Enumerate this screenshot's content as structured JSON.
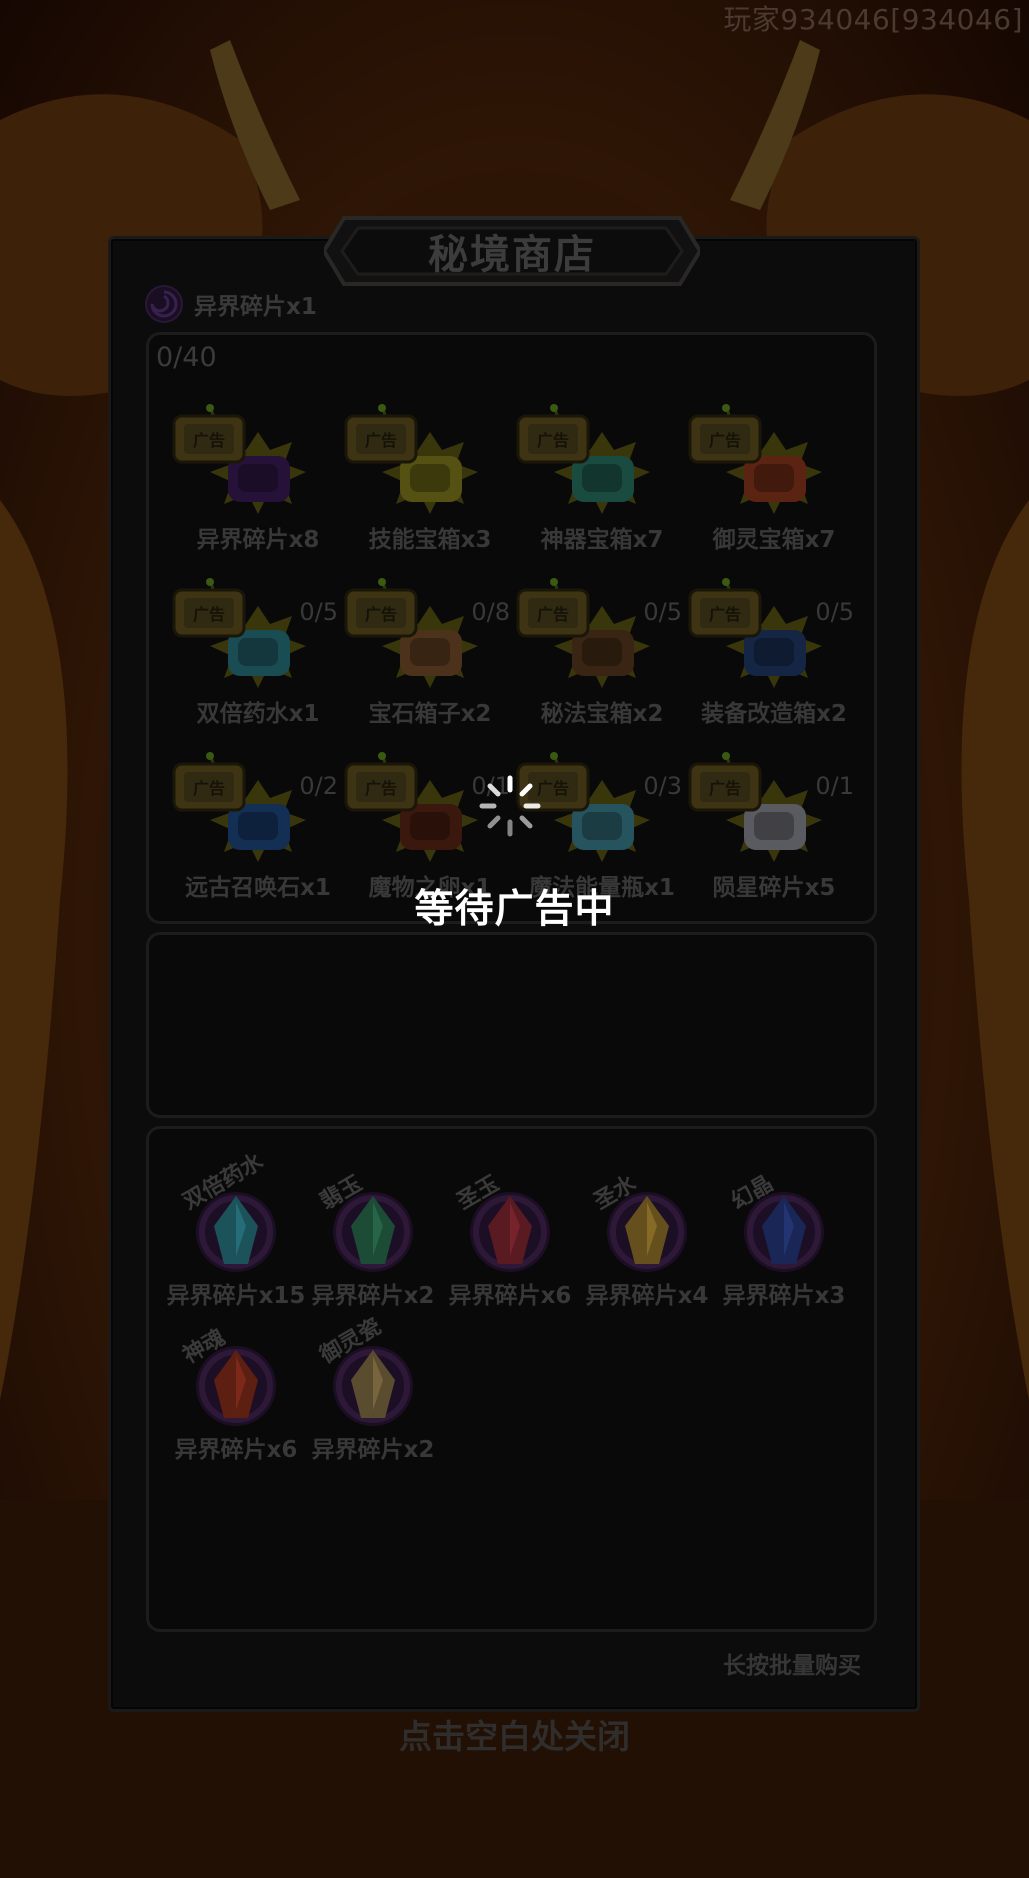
{
  "player": {
    "id_label": "玩家934046[934046]"
  },
  "shop": {
    "title": "秘境商店",
    "currency": {
      "label": "异界碎片x1",
      "icon": "void-fragment-icon"
    },
    "ad_counter": "0/40",
    "ad_items": [
      {
        "label": "异界碎片x8",
        "limit": "",
        "icon": "void-fragment-icon",
        "color": "#5a2a86"
      },
      {
        "label": "技能宝箱x3",
        "limit": "",
        "icon": "skill-chest-icon",
        "color": "#c7c22a"
      },
      {
        "label": "神器宝箱x7",
        "limit": "",
        "icon": "artifact-chest-icon",
        "color": "#3db39a"
      },
      {
        "label": "御灵宝箱x7",
        "limit": "",
        "icon": "spirit-chest-icon",
        "color": "#d8552a"
      },
      {
        "label": "双倍药水x1",
        "limit": "0/5",
        "icon": "double-potion-icon",
        "color": "#3fb6c9"
      },
      {
        "label": "宝石箱子x2",
        "limit": "0/8",
        "icon": "gem-bag-icon",
        "color": "#b87840"
      },
      {
        "label": "秘法宝箱x2",
        "limit": "0/5",
        "icon": "arcane-chest-icon",
        "color": "#8a5530"
      },
      {
        "label": "装备改造箱x2",
        "limit": "0/5",
        "icon": "equip-forge-chest-icon",
        "color": "#2f5aa0"
      },
      {
        "label": "远古召唤石x1",
        "limit": "0/2",
        "icon": "ancient-summon-stone-icon",
        "color": "#2d6fc8"
      },
      {
        "label": "魔物之卵x1",
        "limit": "0/1",
        "icon": "monster-egg-icon",
        "color": "#8a3a22"
      },
      {
        "label": "魔法能量瓶x1",
        "limit": "0/3",
        "icon": "magic-energy-bottle-icon",
        "color": "#5ac7e0"
      },
      {
        "label": "陨星碎片x5",
        "limit": "0/1",
        "icon": "meteor-fragment-icon",
        "color": "#d6d6e6"
      }
    ],
    "exchange_items": [
      {
        "tag": "双倍药水",
        "price": "异界碎片x15",
        "icon": "double-potion-icon",
        "color": "#3fb6c9"
      },
      {
        "tag": "翡玉",
        "price": "异界碎片x2",
        "icon": "jade-icon",
        "color": "#3fa878"
      },
      {
        "tag": "圣玉",
        "price": "异界碎片x6",
        "icon": "holy-jade-icon",
        "color": "#c63a4a"
      },
      {
        "tag": "圣水",
        "price": "异界碎片x4",
        "icon": "holy-water-icon",
        "color": "#e0b040"
      },
      {
        "tag": "幻晶",
        "price": "异界碎片x3",
        "icon": "phantom-crystal-icon",
        "color": "#3a56c0"
      },
      {
        "tag": "神魂",
        "price": "异界碎片x6",
        "icon": "divine-soul-icon",
        "color": "#d0442a"
      },
      {
        "tag": "御灵瓷",
        "price": "异界碎片x2",
        "icon": "spirit-vase-icon",
        "color": "#c8a868"
      }
    ],
    "bulk_buy_hint": "长按批量购买",
    "close_hint": "点击空白处关闭",
    "ad_badge": "广告"
  },
  "overlay": {
    "loading_text": "等待广告中",
    "icon": "loading-spinner-icon"
  }
}
